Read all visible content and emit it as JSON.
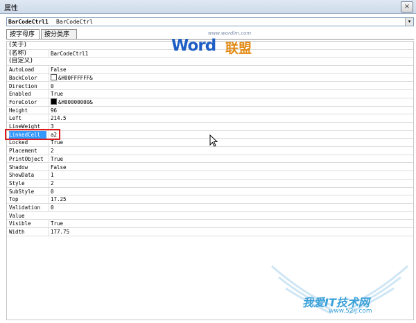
{
  "window": {
    "title": "属性",
    "close_glyph": "×"
  },
  "object_selector": {
    "name": "BarCodeCtrl1",
    "type": "BarCodeCtrl",
    "dropdown_glyph": "▾"
  },
  "tabs": [
    {
      "label": "按字母序",
      "active": true
    },
    {
      "label": "按分类序",
      "active": false
    }
  ],
  "properties": [
    {
      "name": "(关于)",
      "value": ""
    },
    {
      "name": "(名称)",
      "value": "BarCodeCtrl1"
    },
    {
      "name": "(自定义)",
      "value": ""
    },
    {
      "name": "AutoLoad",
      "value": "False"
    },
    {
      "name": "BackColor",
      "value": "&H00FFFFFF&",
      "swatch": "#ffffff"
    },
    {
      "name": "Direction",
      "value": "0"
    },
    {
      "name": "Enabled",
      "value": "True"
    },
    {
      "name": "ForeColor",
      "value": "&H00000000&",
      "swatch": "#000000"
    },
    {
      "name": "Height",
      "value": "96"
    },
    {
      "name": "Left",
      "value": "214.5"
    },
    {
      "name": "LineWeight",
      "value": "3"
    },
    {
      "name": "LinkedCell",
      "value": "a2",
      "selected": true
    },
    {
      "name": "Locked",
      "value": "True"
    },
    {
      "name": "Placement",
      "value": "2"
    },
    {
      "name": "PrintObject",
      "value": "True"
    },
    {
      "name": "Shadow",
      "value": "False"
    },
    {
      "name": "ShowData",
      "value": "1"
    },
    {
      "name": "Style",
      "value": "2"
    },
    {
      "name": "SubStyle",
      "value": "0"
    },
    {
      "name": "Top",
      "value": "17.25"
    },
    {
      "name": "Validation",
      "value": "0"
    },
    {
      "name": "Value",
      "value": ""
    },
    {
      "name": "Visible",
      "value": "True"
    },
    {
      "name": "Width",
      "value": "177.75"
    }
  ],
  "colors": {
    "selection": "#3399ff",
    "highlight_box": "#e0191b"
  },
  "watermarks": {
    "top_url": "www.wordlm.com",
    "top_word": "Word",
    "top_cn": "联盟",
    "bottom_cn": "我爱IT技术网",
    "bottom_url": "www.52ij.com"
  }
}
